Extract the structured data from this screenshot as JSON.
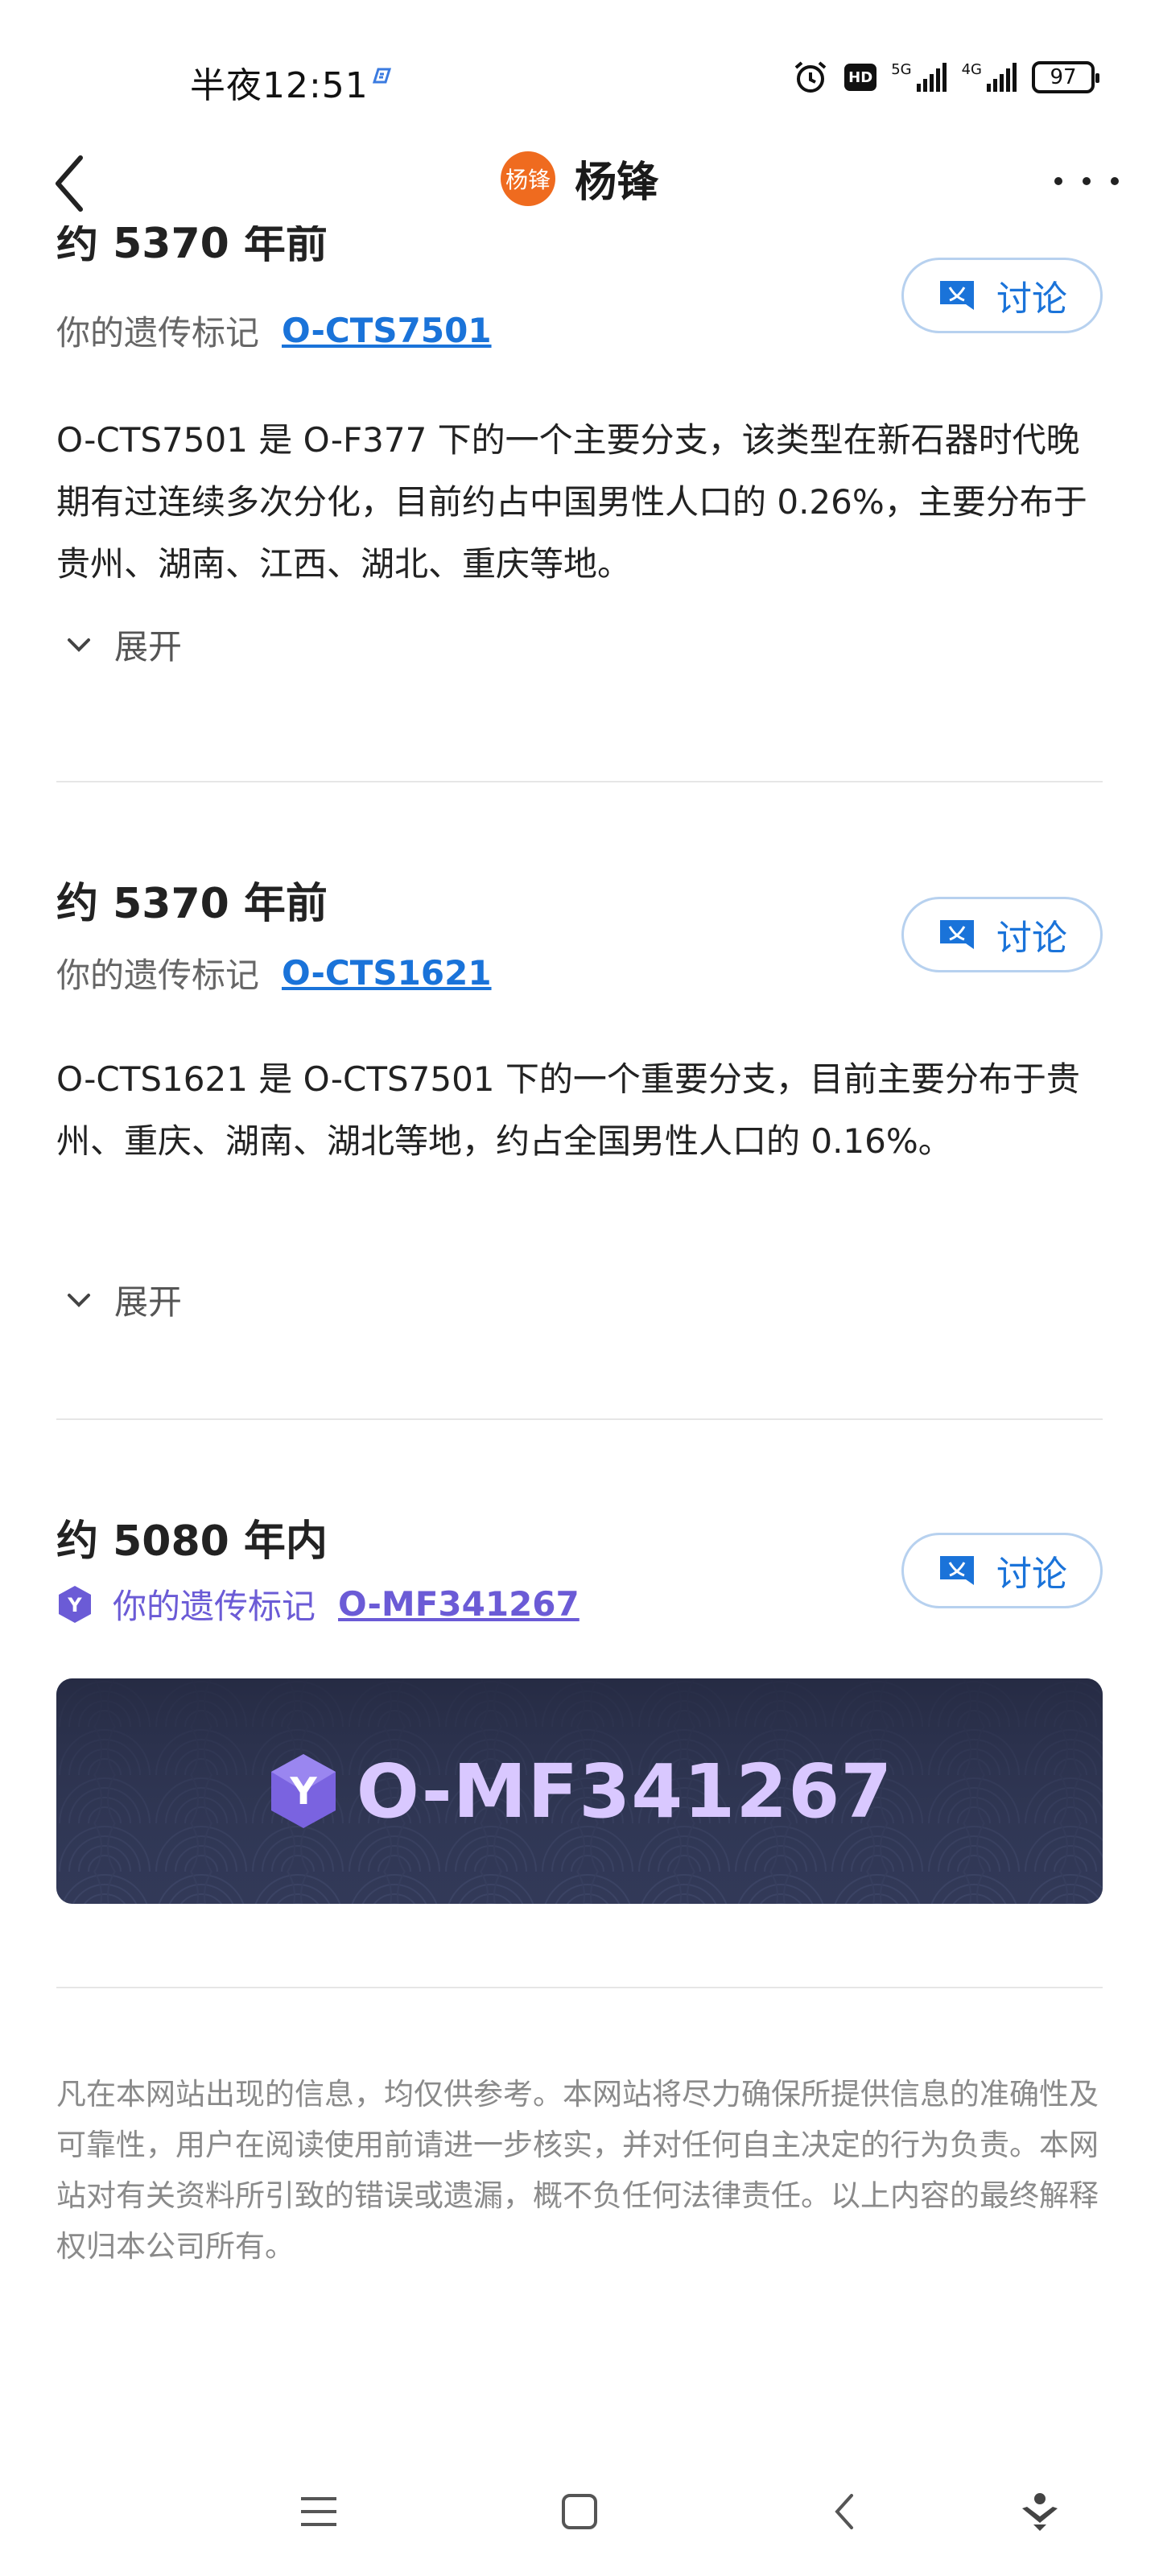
{
  "status_bar": {
    "time": "半夜12:51",
    "signal1": "5G",
    "signal2": "4G",
    "hd": "HD",
    "battery": "97"
  },
  "nav": {
    "title": "杨锋",
    "avatar_text": "杨锋"
  },
  "sections": [
    {
      "heading": "约 5370 年前",
      "marker_label": "你的遗传标记",
      "marker_link": "O-CTS7501",
      "description": "O-CTS7501 是 O-F377 下的一个主要分支，该类型在新石器时代晚期有过连续多次分化，目前约占中国男性人口的 0.26%，主要分布于贵州、湖南、江西、湖北、重庆等地。",
      "expand_label": "展开",
      "discuss_label": "讨论"
    },
    {
      "heading": "约 5370 年前",
      "marker_label": "你的遗传标记",
      "marker_link": "O-CTS1621",
      "description": "O-CTS1621 是 O-CTS7501 下的一个重要分支，目前主要分布于贵州、重庆、湖南、湖北等地，约占全国男性人口的 0.16%。",
      "expand_label": "展开",
      "discuss_label": "讨论"
    },
    {
      "heading": "约 5080 年内",
      "marker_label": "你的遗传标记",
      "marker_link": "O-MF341267",
      "discuss_label": "讨论",
      "badge_letter": "Y"
    }
  ],
  "banner": {
    "text": "O-MF341267",
    "badge_letter": "Y"
  },
  "disclaimer": "凡在本网站出现的信息，均仅供参考。本网站将尽力确保所提供信息的准确性及可靠性，用户在阅读使用前请进一步核实，并对任何自主决定的行为负责。本网站对有关资料所引致的错误或遗漏，概不负任何法律责任。以上内容的最终解释权归本公司所有。",
  "colors": {
    "link": "#1a73d9",
    "purple": "#6b5bd6",
    "banner_bg": "#2c3350",
    "avatar": "#ef6b1f"
  }
}
